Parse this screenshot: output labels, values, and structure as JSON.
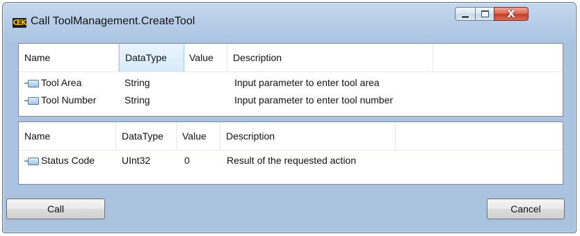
{
  "window": {
    "title": "Call ToolManagement.CreateTool",
    "app_icon_text": "ŒK",
    "controls": {
      "minimize": "minimize-icon",
      "maximize": "maximize-icon",
      "close": "close-icon"
    }
  },
  "inputs": {
    "columns": [
      "Name",
      "DataType",
      "Value",
      "Description"
    ],
    "selected_column": "DataType",
    "rows": [
      {
        "name": "Tool Area",
        "datatype": "String",
        "value": "",
        "description": "Input parameter to enter tool area"
      },
      {
        "name": "Tool Number",
        "datatype": "String",
        "value": "",
        "description": "Input parameter to enter tool number"
      }
    ]
  },
  "outputs": {
    "columns": [
      "Name",
      "DataType",
      "Value",
      "Description"
    ],
    "rows": [
      {
        "name": "Status Code",
        "datatype": "UInt32",
        "value": "0",
        "description": "Result of the requested action"
      }
    ]
  },
  "buttons": {
    "call": "Call",
    "cancel": "Cancel"
  },
  "colors": {
    "window_frame": "#aac3df",
    "header_selected": "#d7ebfb",
    "close_button": "#c33e26"
  }
}
